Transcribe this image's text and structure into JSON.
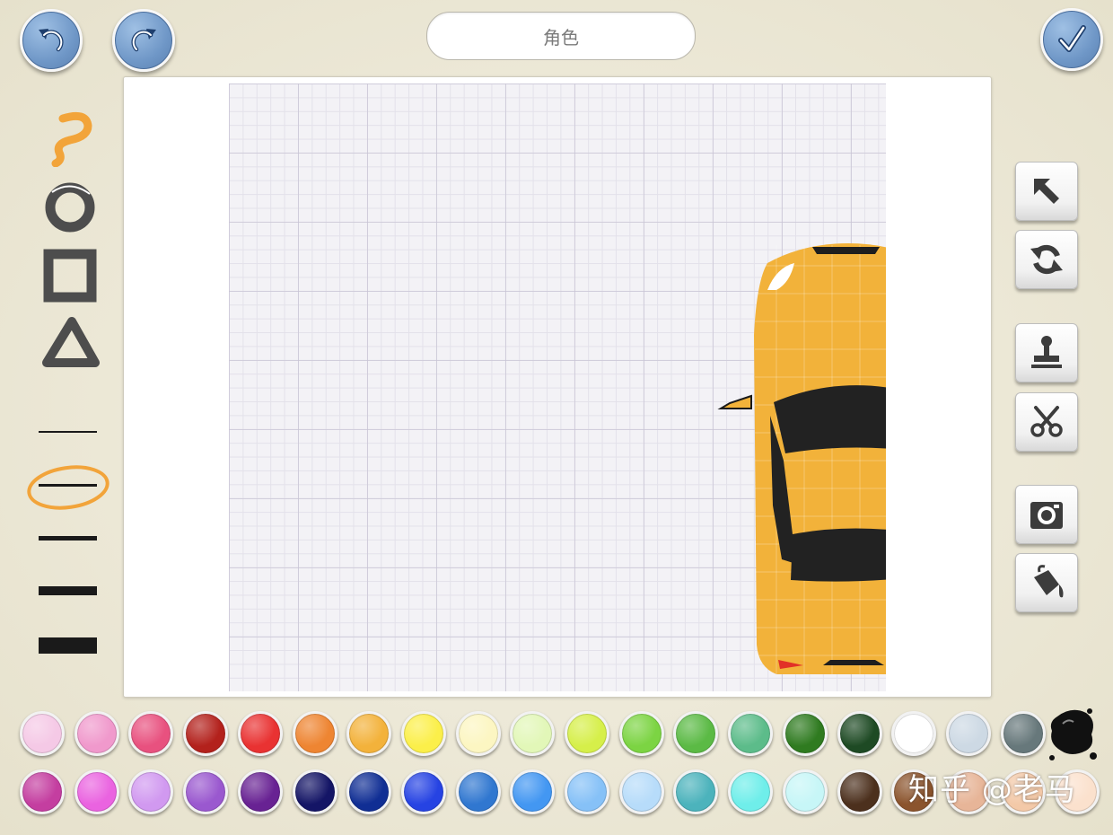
{
  "header": {
    "title_value": "角色",
    "undo_icon": "undo-icon",
    "redo_icon": "redo-icon",
    "done_icon": "checkmark-icon"
  },
  "left_tools": {
    "shapes": [
      "freehand-squiggle-icon",
      "circle-icon",
      "rectangle-icon",
      "triangle-icon"
    ],
    "selected_shape": "freehand-squiggle-icon",
    "line_widths": [
      "thinnest",
      "thin",
      "medium",
      "thick",
      "thickest"
    ],
    "selected_line_width": "thin",
    "accent_color": "#f2a43a"
  },
  "right_tools": [
    "select-arrow-icon",
    "rotate-icon",
    "stamp-icon",
    "scissors-icon",
    "camera-icon",
    "paint-bucket-icon"
  ],
  "canvas": {
    "drawing": "yellow-car-top-view",
    "car_color": "#f2b23a"
  },
  "palette": {
    "row1": [
      "#f5c9e6",
      "#f099cc",
      "#e8517f",
      "#b3211c",
      "#e93232",
      "#ee8532",
      "#f3b23b",
      "#fbef4a",
      "#fcf6c2",
      "#e2f7b8",
      "#d6ef4a",
      "#7cd443",
      "#5bba45",
      "#5cbc8a",
      "#2f7b20",
      "#1e4a24",
      "#ffffff",
      "#cdd9e4",
      "#67787b"
    ],
    "row2": [
      "#c43ea0",
      "#ea63e0",
      "#d199f0",
      "#9a58cf",
      "#682293",
      "#141566",
      "#102e94",
      "#2643e3",
      "#3077d0",
      "#4397f2",
      "#86c1f7",
      "#b7dcfa",
      "#4cb3bc",
      "#6feeea",
      "#c7f6f7",
      "#4c301d",
      "#8b542d",
      "#e7b598",
      "#f3c9a8",
      "#fbe1cd"
    ],
    "ink_icon": "ink-splat-icon"
  },
  "watermark": "知乎 @老马"
}
